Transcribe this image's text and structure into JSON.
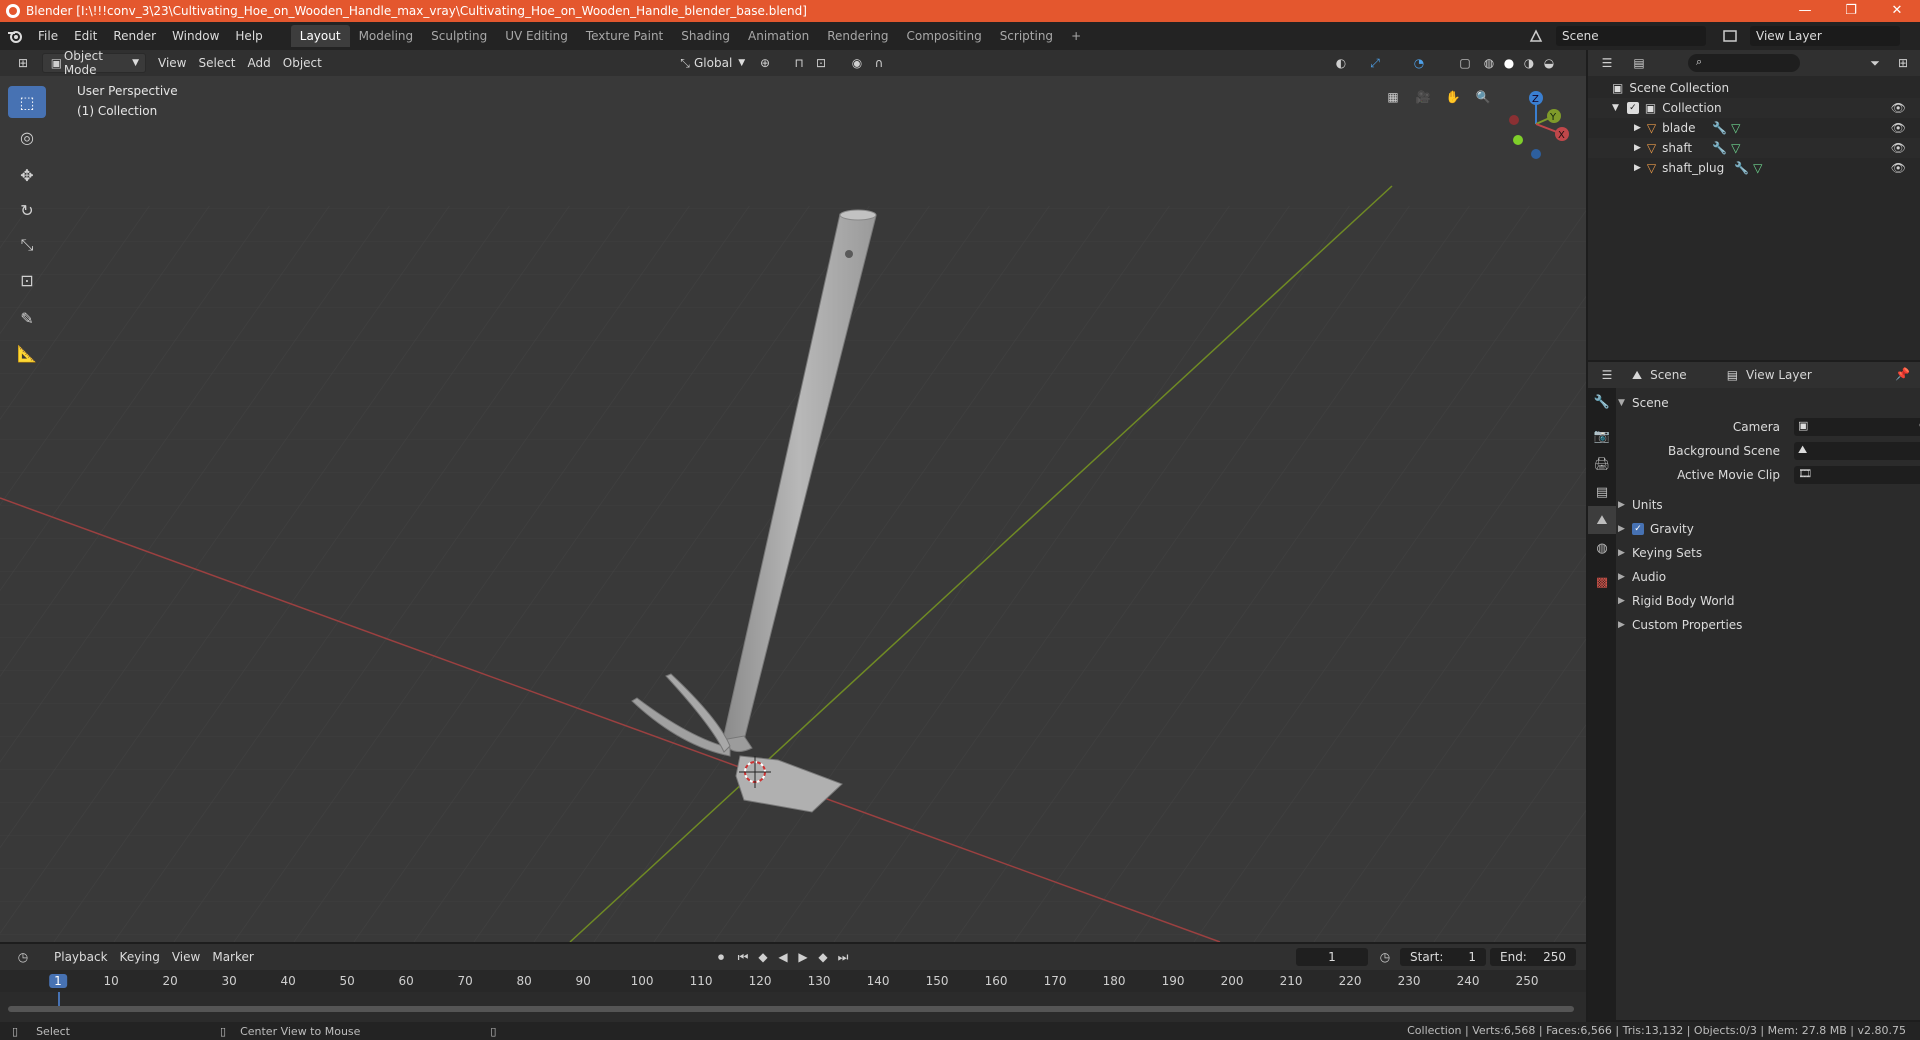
{
  "window": {
    "title": "Blender [I:\\!!!conv_3\\23\\Cultivating_Hoe_on_Wooden_Handle_max_vray\\Cultivating_Hoe_on_Wooden_Handle_blender_base.blend]",
    "minimize": "—",
    "maximize": "❐",
    "close": "✕"
  },
  "menu": [
    "File",
    "Edit",
    "Render",
    "Window",
    "Help"
  ],
  "workspaces": [
    "Layout",
    "Modeling",
    "Sculpting",
    "UV Editing",
    "Texture Paint",
    "Shading",
    "Animation",
    "Rendering",
    "Compositing",
    "Scripting"
  ],
  "workspace_add": "+",
  "scene_name": "Scene",
  "view_layer_name": "View Layer",
  "viewport_header": {
    "mode": "Object Mode",
    "menus": [
      "View",
      "Select",
      "Add",
      "Object"
    ],
    "orientation": "Global"
  },
  "viewport": {
    "perspective": "User Perspective",
    "collection": "(1) Collection",
    "gizmo_labels": {
      "x": "X",
      "y": "Y",
      "z": "Z"
    }
  },
  "timeline": {
    "menus": [
      "Playback",
      "Keying",
      "View",
      "Marker"
    ],
    "current_frame": "1",
    "start_label": "Start:",
    "start": "1",
    "end_label": "End:",
    "end": "250",
    "ticks": [
      "1",
      "10",
      "20",
      "30",
      "40",
      "50",
      "60",
      "70",
      "80",
      "90",
      "100",
      "110",
      "120",
      "130",
      "140",
      "150",
      "160",
      "170",
      "180",
      "190",
      "200",
      "210",
      "220",
      "230",
      "240",
      "250"
    ]
  },
  "statusbar": {
    "left_action": "Select",
    "middle_action": "Center View to Mouse",
    "stats": "Collection | Verts:6,568 | Faces:6,566 | Tris:13,132 | Objects:0/3 | Mem: 27.8 MB | v2.80.75"
  },
  "outliner": {
    "root": "Scene Collection",
    "collection": "Collection",
    "objects": [
      "blade",
      "shaft",
      "shaft_plug"
    ]
  },
  "properties": {
    "breadcrumb_scene": "Scene",
    "breadcrumb_view_layer": "View Layer",
    "panel_title": "Scene",
    "camera_label": "Camera",
    "background_scene_label": "Background Scene",
    "active_movie_clip_label": "Active Movie Clip",
    "sections": [
      "Units",
      "Gravity",
      "Keying Sets",
      "Audio",
      "Rigid Body World",
      "Custom Properties"
    ]
  },
  "colors": {
    "accent": "#4772b3",
    "titlebar": "#e4572e",
    "x_axis": "#c0474a",
    "y_axis": "#7f9b2a",
    "z_axis": "#3a7fd1"
  }
}
